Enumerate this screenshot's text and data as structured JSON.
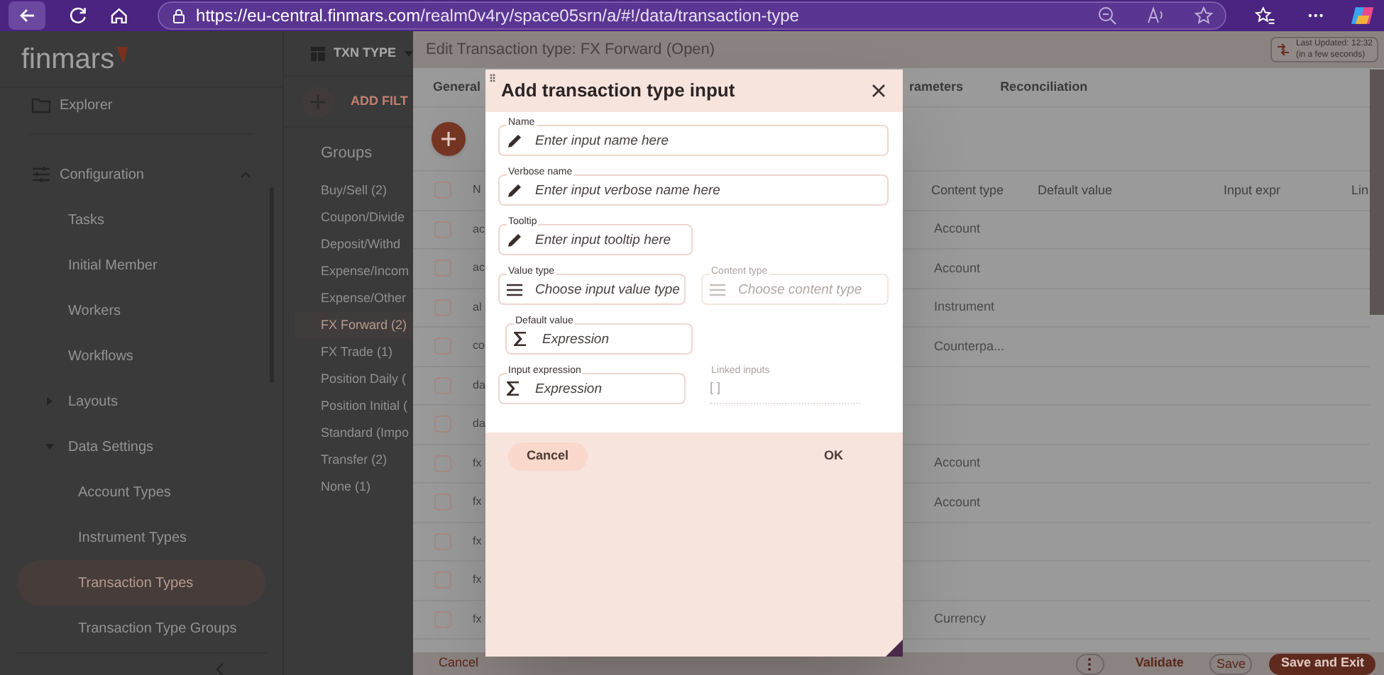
{
  "browser": {
    "url_host": "https://eu-central.finmars.com",
    "url_path": "/realm0v4ry/space05srn/a/#!/data/transaction-type"
  },
  "sidebar": {
    "logo": "finmars",
    "items": [
      {
        "kind": "link",
        "label": "Explorer"
      },
      {
        "kind": "section",
        "label": "Configuration",
        "expanded": true,
        "children": [
          {
            "kind": "link",
            "label": "Tasks",
            "selected": false
          },
          {
            "kind": "link",
            "label": "Initial Member",
            "selected": false
          },
          {
            "kind": "link",
            "label": "Workers",
            "selected": false
          },
          {
            "kind": "link",
            "label": "Workflows",
            "selected": false
          },
          {
            "kind": "folder",
            "label": "Layouts",
            "expanded": false
          },
          {
            "kind": "folder",
            "label": "Data Settings",
            "expanded": true,
            "children": [
              {
                "kind": "link",
                "label": "Account Types",
                "selected": false
              },
              {
                "kind": "link",
                "label": "Instrument Types",
                "selected": false
              },
              {
                "kind": "link",
                "label": "Transaction Types",
                "selected": true
              },
              {
                "kind": "link",
                "label": "Transaction Type Groups",
                "selected": false
              }
            ]
          }
        ]
      }
    ]
  },
  "groups_panel": {
    "view_button": "TXN TYPE",
    "add_filter": "ADD FILT",
    "title": "Groups",
    "items": [
      {
        "label": "Buy/Sell (2)",
        "selected": false
      },
      {
        "label": "Coupon/Divide",
        "selected": false
      },
      {
        "label": "Deposit/Withd",
        "selected": false
      },
      {
        "label": "Expense/Incom",
        "selected": false
      },
      {
        "label": "Expense/Other",
        "selected": false
      },
      {
        "label": "FX Forward (2)",
        "selected": true
      },
      {
        "label": "FX Trade (1)",
        "selected": false
      },
      {
        "label": "Position Daily (",
        "selected": false
      },
      {
        "label": "Position Initial (",
        "selected": false
      },
      {
        "label": "Standard (Impo",
        "selected": false
      },
      {
        "label": "Transfer (2)",
        "selected": false
      },
      {
        "label": "None (1)",
        "selected": false
      }
    ]
  },
  "editor": {
    "title": "Edit Transaction type: FX Forward (Open)",
    "last_updated": "Last Updated: 12:32",
    "last_updated_relative": "(in a few seconds)",
    "tabs": [
      "General",
      "rameters",
      "Reconciliation"
    ],
    "table": {
      "select_all_checked": false,
      "columns": [
        "N",
        "Content type",
        "Default value",
        "Input expr",
        "Lin"
      ],
      "rows": [
        {
          "checked": false,
          "name": "ac",
          "content_type": "Account"
        },
        {
          "checked": false,
          "name": "ac",
          "content_type": "Account"
        },
        {
          "checked": false,
          "name": "al",
          "content_type": "Instrument"
        },
        {
          "checked": false,
          "name": "co",
          "content_type": "Counterpa..."
        },
        {
          "checked": false,
          "name": "da"
        },
        {
          "checked": false,
          "name": "da"
        },
        {
          "checked": false,
          "name": "fx",
          "content_type": "Account"
        },
        {
          "checked": false,
          "name": "fx",
          "content_type": "Account"
        },
        {
          "checked": false,
          "name": "fx"
        },
        {
          "checked": false,
          "name": "fx"
        },
        {
          "checked": false,
          "name": "fx",
          "content_type": "Currency"
        }
      ]
    },
    "footer": {
      "cancel": "Cancel",
      "validate": "Validate",
      "save": "Save",
      "save_and_exit": "Save and Exit"
    }
  },
  "dialog": {
    "title": "Add transaction type input",
    "rows": [
      [
        {
          "kind": "input",
          "label": "Name",
          "placeholder": "Enter input name here",
          "disabled": false
        }
      ],
      [
        {
          "kind": "input",
          "label": "Verbose name",
          "placeholder": "Enter input verbose name here",
          "disabled": false
        }
      ],
      [
        {
          "kind": "input",
          "label": "Tooltip",
          "placeholder": "Enter input tooltip here",
          "disabled": false
        }
      ],
      [
        {
          "kind": "input",
          "label": "Value type",
          "placeholder": "Choose input value type",
          "disabled": false
        },
        {
          "kind": "input",
          "label": "Content type",
          "placeholder": "Choose content type",
          "disabled": true
        }
      ],
      [
        {
          "kind": "input",
          "label": "Default value",
          "placeholder": "Expression",
          "disabled": false
        }
      ],
      [
        {
          "kind": "input",
          "label": "Input expression",
          "placeholder": "Expression",
          "disabled": false
        },
        {
          "kind": "list",
          "label": "Linked inputs",
          "value": "[ ]",
          "disabled": true
        }
      ]
    ],
    "buttons": [
      {
        "kind": "tonal",
        "label": "Cancel"
      },
      {
        "kind": "text",
        "label": "OK"
      }
    ]
  }
}
